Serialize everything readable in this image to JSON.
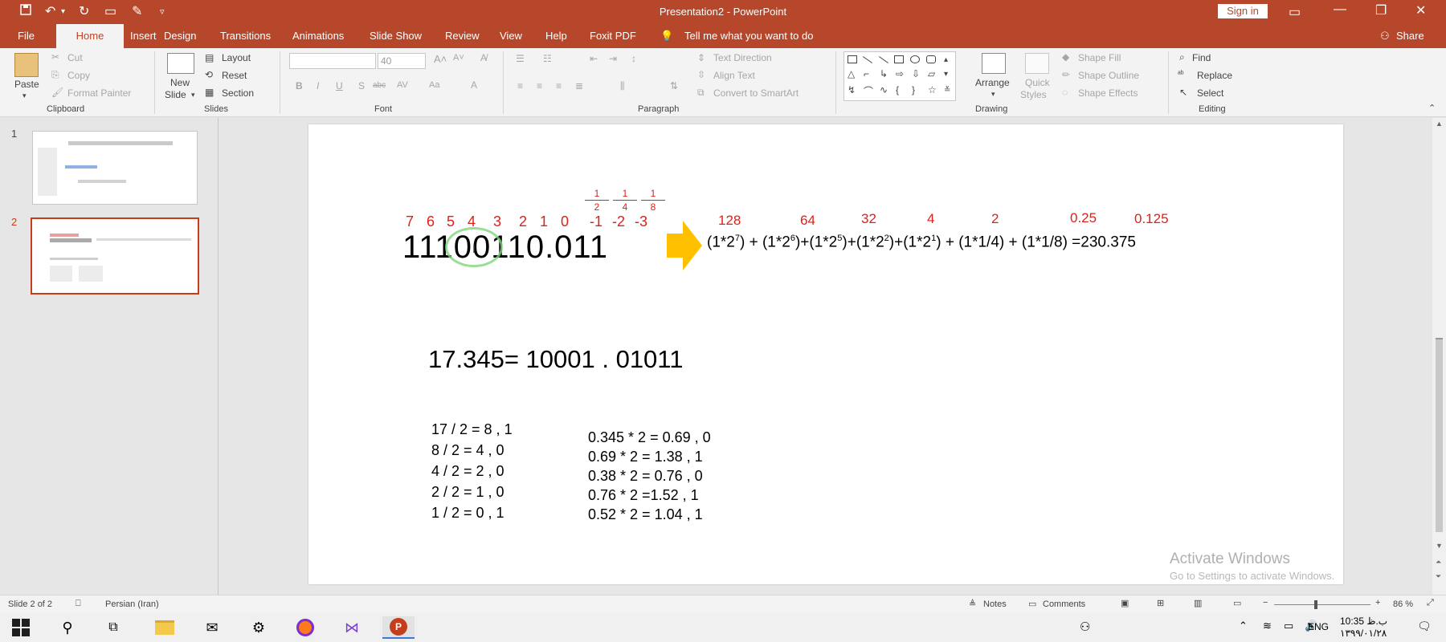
{
  "window": {
    "title": "Presentation2  -  PowerPoint",
    "signin": "Sign in",
    "share": "Share",
    "tell_me": "Tell me what you want to do"
  },
  "tabs": [
    "File",
    "Home",
    "Insert",
    "Design",
    "Transitions",
    "Animations",
    "Slide Show",
    "Review",
    "View",
    "Help",
    "Foxit PDF"
  ],
  "ribbon": {
    "clipboard": {
      "paste": "Paste",
      "cut": "Cut",
      "copy": "Copy",
      "format_painter": "Format Painter",
      "label": "Clipboard"
    },
    "slides": {
      "new_slide_1": "New",
      "new_slide_2": "Slide",
      "layout": "Layout",
      "reset": "Reset",
      "section": "Section",
      "label": "Slides"
    },
    "font": {
      "size": "40",
      "label": "Font"
    },
    "paragraph": {
      "text_direction": "Text Direction",
      "align_text": "Align Text",
      "convert_smartart": "Convert to SmartArt",
      "label": "Paragraph"
    },
    "drawing": {
      "arrange": "Arrange",
      "quick_styles_1": "Quick",
      "quick_styles_2": "Styles",
      "shape_fill": "Shape Fill",
      "shape_outline": "Shape Outline",
      "shape_effects": "Shape Effects",
      "label": "Drawing"
    },
    "editing": {
      "find": "Find",
      "replace": "Replace",
      "select": "Select",
      "label": "Editing"
    }
  },
  "thumbnails": [
    {
      "number": "1",
      "selected": false
    },
    {
      "number": "2",
      "selected": true
    }
  ],
  "slide": {
    "positions": [
      "7",
      "6",
      "5",
      "4",
      "3",
      "2",
      "1",
      "0",
      "-1",
      "-2",
      "-3"
    ],
    "fractions": [
      {
        "num": "1",
        "den": "2"
      },
      {
        "num": "1",
        "den": "4"
      },
      {
        "num": "1",
        "den": "8"
      }
    ],
    "binary": "11100110.011",
    "weights": [
      "128",
      "64",
      "32",
      "4",
      "2",
      "0.25",
      "0.125"
    ],
    "expansion_terms": [
      {
        "base": "(1*2",
        "exp": "7",
        "tail": ") + "
      },
      {
        "base": "(1*2",
        "exp": "6",
        "tail": ")+"
      },
      {
        "base": "(1*2",
        "exp": "5",
        "tail": ")+"
      },
      {
        "base": "(1*2",
        "exp": "2",
        "tail": ")+"
      },
      {
        "base": "(1*2",
        "exp": "1",
        "tail": ") + (1*1/4) + (1*1/8) =230.375"
      }
    ],
    "conversion_title": "17.345= 10001 . 01011",
    "integer_steps": [
      "17 /  2 = 8 , 1",
      "8 / 2 = 4 , 0",
      "4 / 2 = 2 , 0",
      "2 / 2 = 1 , 0",
      "1 / 2 = 0 , 1"
    ],
    "fraction_steps": [
      "0.345 * 2 = 0.69  , 0",
      "0.69 * 2 = 1.38 , 1",
      "0.38 * 2 = 0.76 , 0",
      "0.76 * 2 =1.52 , 1",
      "0.52 * 2 = 1.04 , 1"
    ]
  },
  "watermark": {
    "line1": "Activate Windows",
    "line2": "Go to Settings to activate Windows."
  },
  "status": {
    "slide_info": "Slide 2 of 2",
    "language": "Persian (Iran)",
    "notes": "Notes",
    "comments": "Comments",
    "zoom": "86 %"
  },
  "taskbar": {
    "lang": "ENG",
    "time": "10:35 ب.ظ",
    "date": "۱۳۹۹/۰۱/۲۸"
  },
  "colors": {
    "accent": "#b7472a",
    "red_text": "#e0201a",
    "arrow": "#ffc000",
    "highlight_circle": "#7ed67a"
  }
}
